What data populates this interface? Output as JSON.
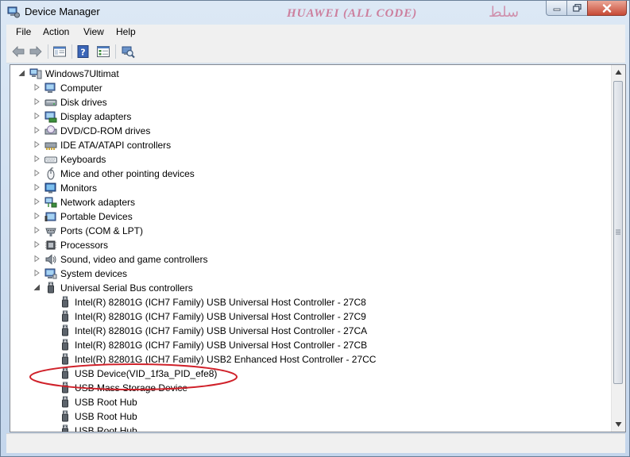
{
  "window": {
    "title": "Device Manager",
    "watermark": "HUAWEI (ALL CODE)",
    "watermark_glyph": "ﺳﻠﻂ"
  },
  "menubar": {
    "items": [
      "File",
      "Action",
      "View",
      "Help"
    ]
  },
  "toolbar": {
    "icons": [
      "back-arrow-icon",
      "forward-arrow-icon",
      "show-hide-console-tree-icon",
      "help-icon",
      "properties-icon",
      "scan-hardware-icon"
    ]
  },
  "tree": {
    "root": "Windows7Ultimat",
    "categories": [
      {
        "label": "Computer",
        "icon": "computer-icon"
      },
      {
        "label": "Disk drives",
        "icon": "disk-drive-icon"
      },
      {
        "label": "Display adapters",
        "icon": "display-adapter-icon"
      },
      {
        "label": "DVD/CD-ROM drives",
        "icon": "dvd-drive-icon"
      },
      {
        "label": "IDE ATA/ATAPI controllers",
        "icon": "ide-controller-icon"
      },
      {
        "label": "Keyboards",
        "icon": "keyboard-icon"
      },
      {
        "label": "Mice and other pointing devices",
        "icon": "mouse-icon"
      },
      {
        "label": "Monitors",
        "icon": "monitor-icon"
      },
      {
        "label": "Network adapters",
        "icon": "network-adapter-icon"
      },
      {
        "label": "Portable Devices",
        "icon": "portable-device-icon"
      },
      {
        "label": "Ports (COM & LPT)",
        "icon": "port-icon"
      },
      {
        "label": "Processors",
        "icon": "processor-icon"
      },
      {
        "label": "Sound, video and game controllers",
        "icon": "sound-icon"
      },
      {
        "label": "System devices",
        "icon": "system-device-icon"
      },
      {
        "label": "Universal Serial Bus controllers",
        "icon": "usb-icon"
      }
    ],
    "usb_children": [
      "Intel(R) 82801G (ICH7 Family) USB Universal Host Controller - 27C8",
      "Intel(R) 82801G (ICH7 Family) USB Universal Host Controller - 27C9",
      "Intel(R) 82801G (ICH7 Family) USB Universal Host Controller - 27CA",
      "Intel(R) 82801G (ICH7 Family) USB Universal Host Controller - 27CB",
      "Intel(R) 82801G (ICH7 Family) USB2 Enhanced Host Controller - 27CC",
      "USB Device(VID_1f3a_PID_efe8)",
      "USB Mass Storage Device",
      "USB Root Hub",
      "USB Root Hub",
      "USB Root Hub"
    ]
  },
  "colors": {
    "annotation": "#d0212a",
    "title_bar_top": "#dce8f5",
    "close_button": "#c74a36"
  }
}
